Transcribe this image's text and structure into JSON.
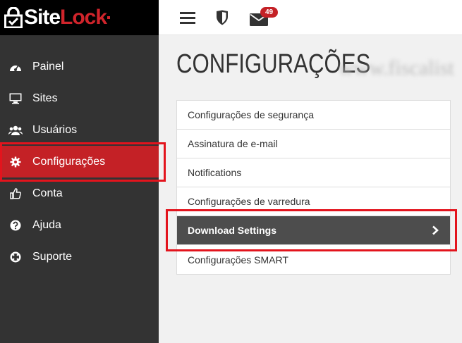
{
  "brand": {
    "part1": "Site",
    "part2": "Lock",
    "accent": "#d0242b"
  },
  "sidebar": {
    "items": [
      {
        "label": "Painel",
        "icon": "dashboard-icon"
      },
      {
        "label": "Sites",
        "icon": "monitor-icon"
      },
      {
        "label": "Usuários",
        "icon": "users-icon"
      },
      {
        "label": "Configurações",
        "icon": "gear-icon",
        "active": true
      },
      {
        "label": "Conta",
        "icon": "thumbs-up-icon"
      },
      {
        "label": "Ajuda",
        "icon": "question-icon"
      },
      {
        "label": "Suporte",
        "icon": "lifebuoy-icon"
      }
    ]
  },
  "topbar": {
    "messages_count": "49"
  },
  "main": {
    "title": "CONFIGURAÇÕES",
    "menu": [
      {
        "label": "Configurações de segurança"
      },
      {
        "label": "Assinatura de e-mail"
      },
      {
        "label": "Notifications"
      },
      {
        "label": "Configurações de varredura"
      },
      {
        "label": "Download Settings",
        "active": true
      },
      {
        "label": "Configurações SMART"
      }
    ]
  },
  "colors": {
    "sidebar_bg": "#333333",
    "active_red": "#c42126",
    "highlight": "#e3141d",
    "menu_active_bg": "#4d4d4d"
  }
}
